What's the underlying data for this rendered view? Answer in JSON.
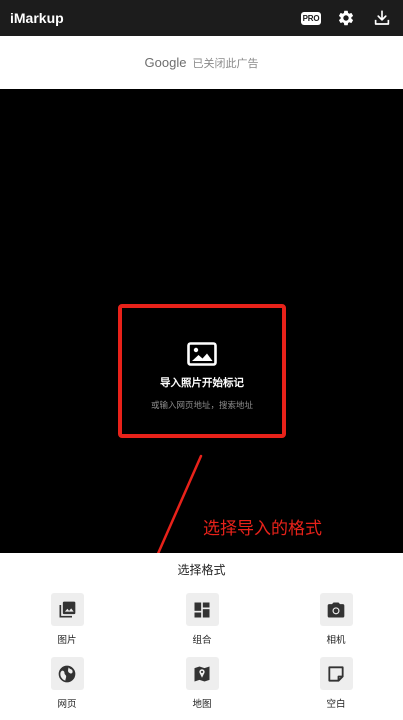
{
  "app": {
    "title": "iMarkup"
  },
  "toolbar": {
    "pro_label": "PRO",
    "icons": [
      "pro-badge",
      "gear-icon",
      "download-icon"
    ]
  },
  "ad": {
    "brand": "Google",
    "text": "已关闭此广告"
  },
  "import": {
    "title": "导入照片开始标记",
    "subtitle": "或输入网页地址，搜索地址"
  },
  "annotation": {
    "text": "选择导入的格式",
    "color": "#e8221a"
  },
  "sheet": {
    "title": "选择格式",
    "items": [
      {
        "label": "图片",
        "icon": "photos-icon"
      },
      {
        "label": "组合",
        "icon": "collage-icon"
      },
      {
        "label": "相机",
        "icon": "camera-icon"
      },
      {
        "label": "网页",
        "icon": "globe-icon"
      },
      {
        "label": "地图",
        "icon": "map-icon"
      },
      {
        "label": "空白",
        "icon": "blank-note-icon"
      }
    ]
  },
  "colors": {
    "topbar": "#1c1c1c",
    "canvas": "#000000",
    "accent_red": "#e8221a",
    "tile_bg": "#eeeeee",
    "icon": "#333333"
  }
}
